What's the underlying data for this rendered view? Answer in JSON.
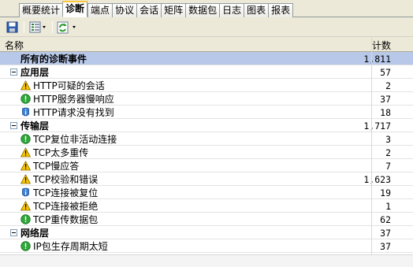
{
  "tabs": [
    {
      "label": "概要统计",
      "active": false
    },
    {
      "label": "诊断",
      "active": true
    },
    {
      "label": "端点",
      "active": false
    },
    {
      "label": "协议",
      "active": false
    },
    {
      "label": "会话",
      "active": false
    },
    {
      "label": "矩阵",
      "active": false
    },
    {
      "label": "数据包",
      "active": false
    },
    {
      "label": "日志",
      "active": false
    },
    {
      "label": "图表",
      "active": false
    },
    {
      "label": "报表",
      "active": false
    }
  ],
  "toolbar": {
    "icons": [
      "save-icon",
      "list-options-icon",
      "refresh-icon"
    ]
  },
  "table": {
    "columns": {
      "name": "名称",
      "count": "计数"
    },
    "all_row": {
      "label": "所有的诊断事件",
      "count": "1,811"
    },
    "groups": [
      {
        "label": "应用层",
        "count": "57",
        "items": [
          {
            "icon": "warning",
            "label": "HTTP可疑的会话",
            "count": "2"
          },
          {
            "icon": "error",
            "label": "HTTP服务器慢响应",
            "count": "37"
          },
          {
            "icon": "info",
            "label": "HTTP请求没有找到",
            "count": "18"
          }
        ]
      },
      {
        "label": "传输层",
        "count": "1,717",
        "items": [
          {
            "icon": "error",
            "label": "TCP复位非活动连接",
            "count": "3"
          },
          {
            "icon": "warning",
            "label": "TCP太多重传",
            "count": "2"
          },
          {
            "icon": "warning",
            "label": "TCP慢应答",
            "count": "7"
          },
          {
            "icon": "warning",
            "label": "TCP校验和错误",
            "count": "1,623"
          },
          {
            "icon": "info",
            "label": "TCP连接被复位",
            "count": "19"
          },
          {
            "icon": "warning",
            "label": "TCP连接被拒绝",
            "count": "1"
          },
          {
            "icon": "error",
            "label": "TCP重传数据包",
            "count": "62"
          }
        ]
      },
      {
        "label": "网络层",
        "count": "37",
        "items": [
          {
            "icon": "error",
            "label": "IP包生存周期太短",
            "count": "37"
          }
        ]
      }
    ]
  },
  "colors": {
    "selection": "#b8c8e8",
    "warning": "#f5c400",
    "error": "#2fa83a",
    "info": "#3b7fd6"
  }
}
